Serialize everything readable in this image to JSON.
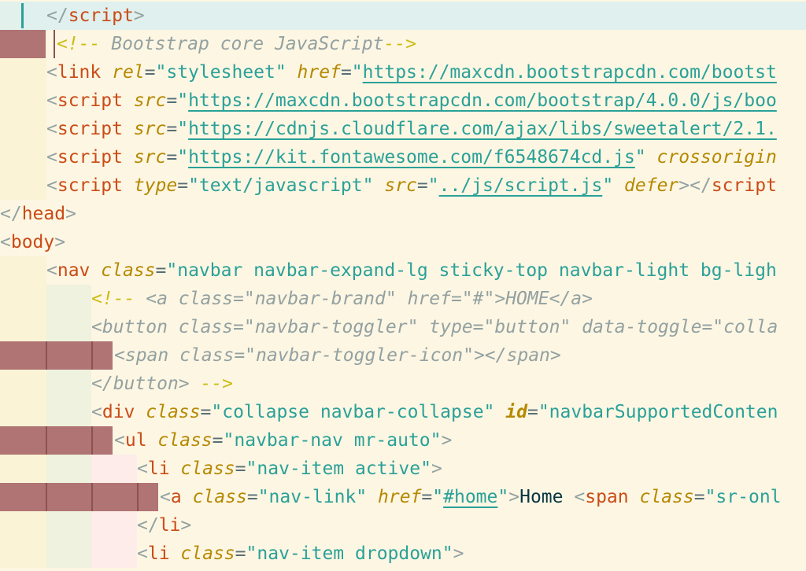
{
  "editor": {
    "language": "html",
    "lines": [
      {
        "parts": [
          "</",
          "script",
          ">"
        ]
      },
      {
        "parts": [
          "<!--",
          " Bootstrap core JavaScript",
          "-->"
        ]
      },
      {
        "parts": [
          "<",
          "link",
          " ",
          "rel",
          "=",
          "\"stylesheet\"",
          " ",
          "href",
          "=",
          "\"",
          "https://maxcdn.bootstrapcdn.com/bootst"
        ]
      },
      {
        "parts": [
          "<",
          "script",
          " ",
          "src",
          "=",
          "\"",
          "https://maxcdn.bootstrapcdn.com/bootstrap/4.0.0/js/boo"
        ]
      },
      {
        "parts": [
          "<",
          "script",
          " ",
          "src",
          "=",
          "\"",
          "https://cdnjs.cloudflare.com/ajax/libs/sweetalert/2.1."
        ]
      },
      {
        "parts": [
          "<",
          "script",
          " ",
          "src",
          "=",
          "\"",
          "https://kit.fontawesome.com/f6548674cd.js",
          "\"",
          " ",
          "crossorigin"
        ]
      },
      {
        "parts": [
          "<",
          "script",
          " ",
          "type",
          "=",
          "\"text/javascript\"",
          " ",
          "src",
          "=",
          "\"",
          "../js/script.js",
          "\"",
          " ",
          "defer",
          "></",
          "script"
        ]
      },
      {
        "parts": [
          "</",
          "head",
          ">"
        ]
      },
      {
        "parts": [
          "<",
          "body",
          ">"
        ]
      },
      {
        "parts": [
          "<",
          "nav",
          " ",
          "class",
          "=",
          "\"navbar navbar-expand-lg sticky-top navbar-light bg-ligh"
        ]
      },
      {
        "parts": [
          "<!--",
          " <a class=\"navbar-brand\" href=\"#\">HOME</a>"
        ]
      },
      {
        "parts": [
          "<button class=\"navbar-toggler\" type=\"button\" data-toggle=\"colla"
        ]
      },
      {
        "parts": [
          "<span class=\"navbar-toggler-icon\"></span>"
        ]
      },
      {
        "parts": [
          "</button> ",
          "-->"
        ]
      },
      {
        "parts": [
          "<",
          "div",
          " ",
          "class",
          "=",
          "\"collapse navbar-collapse\"",
          " ",
          "id",
          "=",
          "\"navbarSupportedConten"
        ]
      },
      {
        "parts": [
          "<",
          "ul",
          " ",
          "class",
          "=",
          "\"navbar-nav mr-auto\"",
          ">"
        ]
      },
      {
        "parts": [
          "<",
          "li",
          " ",
          "class",
          "=",
          "\"nav-item active\"",
          ">"
        ]
      },
      {
        "parts": [
          "<",
          "a",
          " ",
          "class",
          "=",
          "\"nav-link\"",
          " ",
          "href",
          "=",
          "\"",
          "#home",
          "\"",
          ">",
          "Home ",
          "<",
          "span",
          " ",
          "class",
          "=",
          "\"sr-onl"
        ]
      },
      {
        "parts": [
          "</",
          "li",
          ">"
        ]
      },
      {
        "parts": [
          "<",
          "li",
          " ",
          "class",
          "=",
          "\"nav-item dropdown\"",
          ">"
        ]
      }
    ]
  }
}
